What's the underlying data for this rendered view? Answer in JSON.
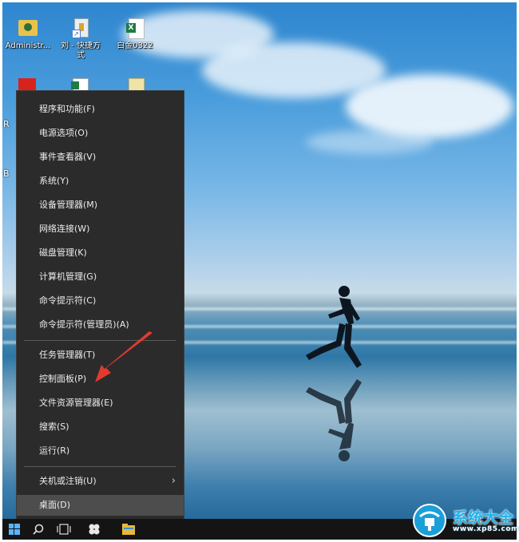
{
  "desktop": {
    "icons": [
      {
        "label": "Administr..."
      },
      {
        "label": "刘 - 快捷方式"
      },
      {
        "label": "白金0322"
      }
    ],
    "partial_left_letters": [
      "R",
      "B"
    ]
  },
  "context_menu": {
    "group1": [
      {
        "label": "程序和功能(F)"
      },
      {
        "label": "电源选项(O)"
      },
      {
        "label": "事件查看器(V)"
      },
      {
        "label": "系统(Y)"
      },
      {
        "label": "设备管理器(M)"
      },
      {
        "label": "网络连接(W)"
      },
      {
        "label": "磁盘管理(K)"
      },
      {
        "label": "计算机管理(G)"
      },
      {
        "label": "命令提示符(C)"
      },
      {
        "label": "命令提示符(管理员)(A)"
      }
    ],
    "group2": [
      {
        "label": "任务管理器(T)"
      },
      {
        "label": "控制面板(P)"
      },
      {
        "label": "文件资源管理器(E)"
      },
      {
        "label": "搜索(S)"
      },
      {
        "label": "运行(R)"
      }
    ],
    "group3": [
      {
        "label": "关机或注销(U)",
        "has_submenu": true,
        "chevron": "›"
      },
      {
        "label": "桌面(D)"
      }
    ]
  },
  "taskbar": {
    "buttons": [
      "windows-start-icon",
      "search-icon",
      "task-view-icon",
      "app-icon",
      "explorer-icon"
    ]
  },
  "watermark": {
    "title": "系统大全",
    "url": "www.xp85.com",
    "color": "#1a9fd8"
  },
  "colors": {
    "menu_bg": "#2b2b2b",
    "menu_text": "#ececec",
    "arrow": "#e23a2e"
  }
}
